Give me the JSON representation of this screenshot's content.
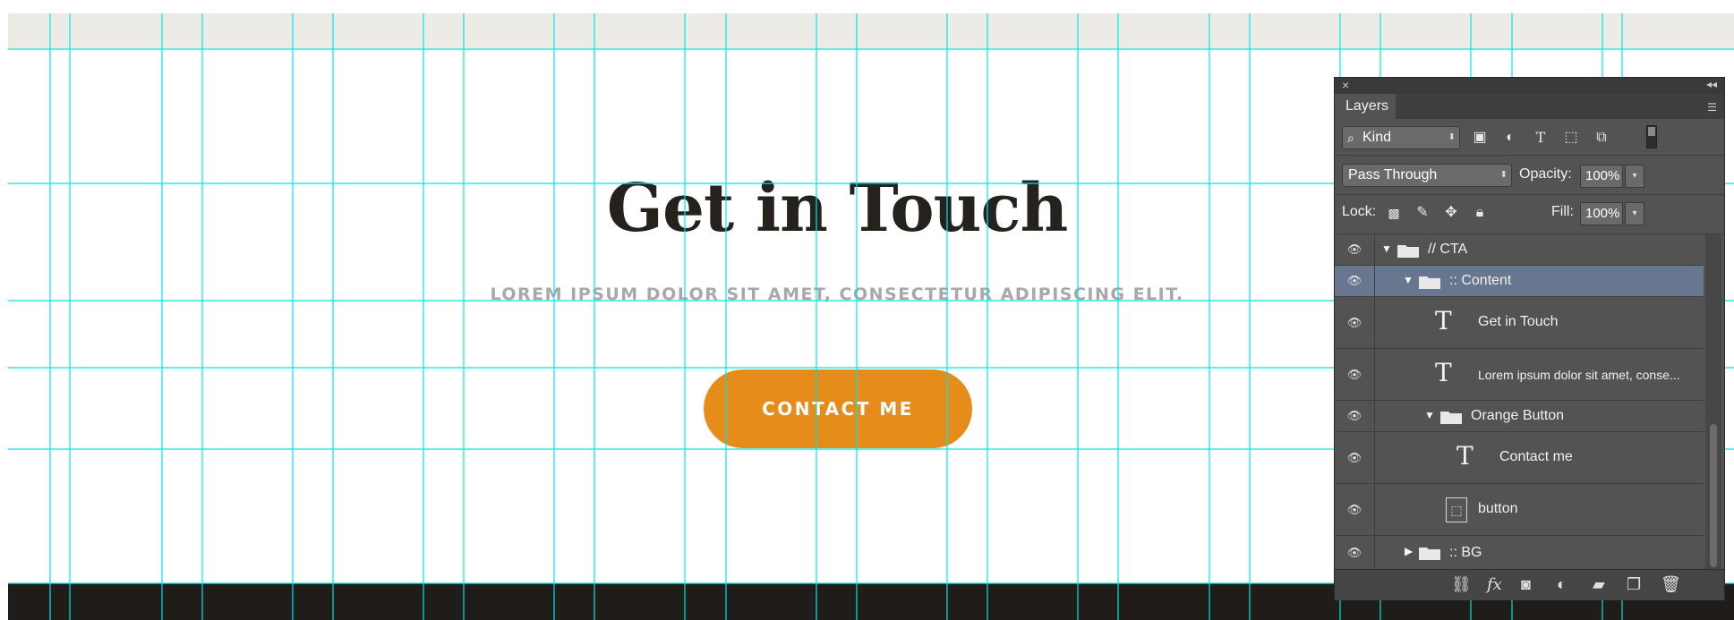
{
  "canvas": {
    "headline": "Get in Touch",
    "subline": "LOREM IPSUM DOLOR SIT AMET, CONSECTETUR ADIPISCING ELIT.",
    "button_label": "CONTACT ME",
    "colors": {
      "accent": "#e68c1a",
      "text_dark": "#25221e",
      "guides": "#00e5e5",
      "footer": "#1f1c19",
      "top_band": "#ecebe6"
    }
  },
  "layers_panel": {
    "close_glyph": "×",
    "collapse_glyph": "◂◂",
    "tab_label": "Layers",
    "filter": {
      "value": "Kind"
    },
    "blend_mode": "Pass Through",
    "opacity_label": "Opacity:",
    "opacity_value": "100%",
    "lock_label": "Lock:",
    "fill_label": "Fill:",
    "fill_value": "100%",
    "layers": [
      {
        "name": "// CTA",
        "kind": "group",
        "expanded": true
      },
      {
        "name": ":: Content",
        "kind": "group",
        "expanded": true,
        "selected": true
      },
      {
        "name": "Get in Touch",
        "kind": "text"
      },
      {
        "name": "Lorem ipsum dolor sit amet, conse...",
        "kind": "text"
      },
      {
        "name": "Orange Button",
        "kind": "group",
        "expanded": true
      },
      {
        "name": "Contact me",
        "kind": "text"
      },
      {
        "name": "button",
        "kind": "shape"
      },
      {
        "name": ":: BG",
        "kind": "group",
        "expanded": false
      }
    ],
    "footer_icons": [
      "link-icon",
      "fx-icon",
      "mask-icon",
      "adjustment-icon",
      "folder-icon",
      "new-layer-icon",
      "trash-icon"
    ]
  }
}
